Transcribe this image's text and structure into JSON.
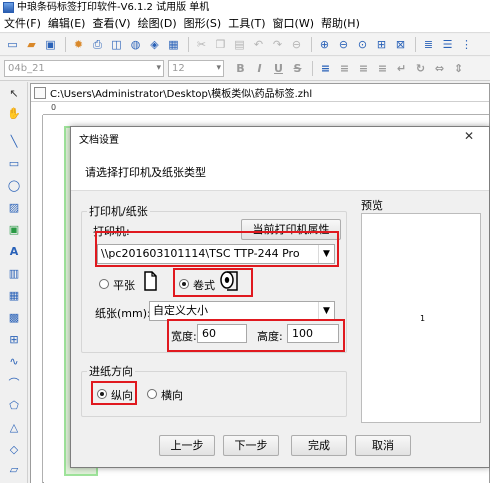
{
  "app": {
    "title": "中琅条码标签打印软件-V6.1.2 试用版 单机"
  },
  "menu": [
    "文件(F)",
    "编辑(E)",
    "查看(V)",
    "绘图(D)",
    "图形(S)",
    "工具(T)",
    "窗口(W)",
    "帮助(H)"
  ],
  "format_bar": {
    "font_name": "04b_21",
    "font_size": "12",
    "bold": "B",
    "italic": "I",
    "underline": "U",
    "strike": "S"
  },
  "document": {
    "path": "C:\\Users\\Administrator\\Desktop\\模板类似\\药品标签.zhl",
    "ruler_zero": "0"
  },
  "dialog": {
    "title": "文档设置",
    "close": "✕",
    "header": "请选择打印机及纸张类型",
    "printer_group": "打印机/纸张",
    "printer_label": "打印机:",
    "printer_props_button": "当前打印机属性",
    "printer_selected": "\\\\pc201603101114\\TSC TTP-244 Pro",
    "sheet_label": "平张",
    "roll_label": "卷式",
    "paper_label": "纸张(mm):",
    "paper_selected": "自定义大小",
    "width_label": "宽度:",
    "width_value": "60",
    "height_label": "高度:",
    "height_value": "100",
    "feed_group": "进纸方向",
    "portrait_label": "纵向",
    "landscape_label": "横向",
    "preview_label": "预览",
    "preview_page": "1",
    "buttons": {
      "prev": "上一步",
      "next": "下一步",
      "finish": "完成",
      "cancel": "取消"
    }
  }
}
